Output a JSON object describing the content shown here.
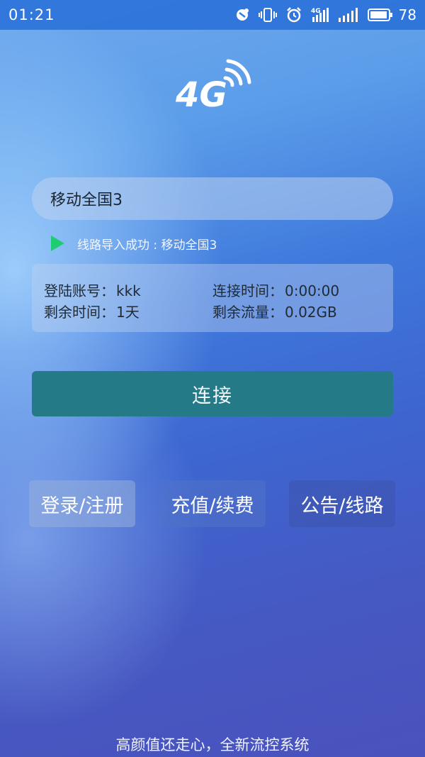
{
  "status_bar": {
    "time": "01:21",
    "battery_level": "78",
    "icons": [
      "nfc-icon",
      "vibrate-icon",
      "alarm-icon",
      "4g-signal-icon",
      "cellular-signal-icon",
      "battery-icon"
    ]
  },
  "logo": {
    "text": "4G"
  },
  "line_select": {
    "value": "移动全国3"
  },
  "import_status": {
    "text": "线路导入成功 : 移动全国3",
    "icon_color": "#1fcc73"
  },
  "info": {
    "account_label": "登陆账号：",
    "account_value": "kkk",
    "connect_time_label": "连接时间：",
    "connect_time_value": "0:00:00",
    "remaining_time_label": "剩余时间：",
    "remaining_time_value": "1天",
    "remaining_traffic_label": "剩余流量：",
    "remaining_traffic_value": "0.02GB"
  },
  "connect_button": {
    "label": "连接",
    "color": "#247a87"
  },
  "actions": {
    "login_label": "登录/注册",
    "recharge_label": "充值/续费",
    "notice_label": "公告/线路"
  },
  "footer": {
    "slogan": "高颜值还走心，全新流控系统"
  }
}
